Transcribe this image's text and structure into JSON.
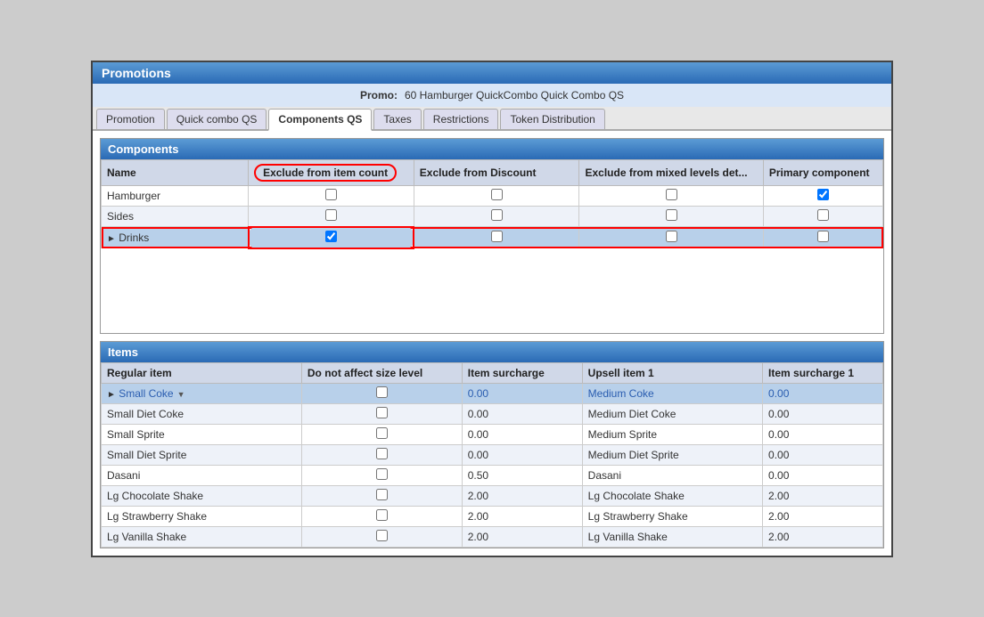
{
  "title": "Promotions",
  "promo": {
    "label": "Promo:",
    "value": "60 Hamburger QuickCombo Quick Combo QS"
  },
  "tabs": [
    {
      "label": "Promotion",
      "active": false
    },
    {
      "label": "Quick combo QS",
      "active": false
    },
    {
      "label": "Components QS",
      "active": true
    },
    {
      "label": "Taxes",
      "active": false
    },
    {
      "label": "Restrictions",
      "active": false
    },
    {
      "label": "Token Distribution",
      "active": false
    }
  ],
  "components": {
    "header": "Components",
    "columns": [
      "Name",
      "Exclude from item count",
      "Exclude from Discount",
      "Exclude from mixed levels det...",
      "Primary component"
    ],
    "rows": [
      {
        "name": "Hamburger",
        "excludeItemCount": false,
        "excludeDiscount": false,
        "excludeMixed": false,
        "primary": true,
        "selected": false,
        "expanded": false
      },
      {
        "name": "Sides",
        "excludeItemCount": false,
        "excludeDiscount": false,
        "excludeMixed": false,
        "primary": false,
        "selected": false,
        "expanded": false
      },
      {
        "name": "Drinks",
        "excludeItemCount": true,
        "excludeDiscount": false,
        "excludeMixed": false,
        "primary": false,
        "selected": true,
        "expanded": true
      }
    ]
  },
  "items": {
    "header": "Items",
    "columns": [
      "Regular item",
      "Do not affect size level",
      "Item surcharge",
      "Upsell item 1",
      "Item surcharge 1"
    ],
    "rows": [
      {
        "name": "Small Coke",
        "doNotAffect": false,
        "surcharge": "0.00",
        "upsell": "Medium Coke",
        "upsellSurcharge": "0.00",
        "selected": true
      },
      {
        "name": "Small Diet Coke",
        "doNotAffect": false,
        "surcharge": "0.00",
        "upsell": "Medium Diet Coke",
        "upsellSurcharge": "0.00",
        "selected": false
      },
      {
        "name": "Small Sprite",
        "doNotAffect": false,
        "surcharge": "0.00",
        "upsell": "Medium Sprite",
        "upsellSurcharge": "0.00",
        "selected": false
      },
      {
        "name": "Small Diet Sprite",
        "doNotAffect": false,
        "surcharge": "0.00",
        "upsell": "Medium Diet Sprite",
        "upsellSurcharge": "0.00",
        "selected": false
      },
      {
        "name": "Dasani",
        "doNotAffect": false,
        "surcharge": "0.50",
        "upsell": "Dasani",
        "upsellSurcharge": "0.00",
        "selected": false
      },
      {
        "name": "Lg Chocolate Shake",
        "doNotAffect": false,
        "surcharge": "2.00",
        "upsell": "Lg Chocolate Shake",
        "upsellSurcharge": "2.00",
        "selected": false
      },
      {
        "name": "Lg Strawberry Shake",
        "doNotAffect": false,
        "surcharge": "2.00",
        "upsell": "Lg Strawberry Shake",
        "upsellSurcharge": "2.00",
        "selected": false
      },
      {
        "name": "Lg Vanilla Shake",
        "doNotAffect": false,
        "surcharge": "2.00",
        "upsell": "Lg Vanilla Shake",
        "upsellSurcharge": "2.00",
        "selected": false
      }
    ]
  }
}
